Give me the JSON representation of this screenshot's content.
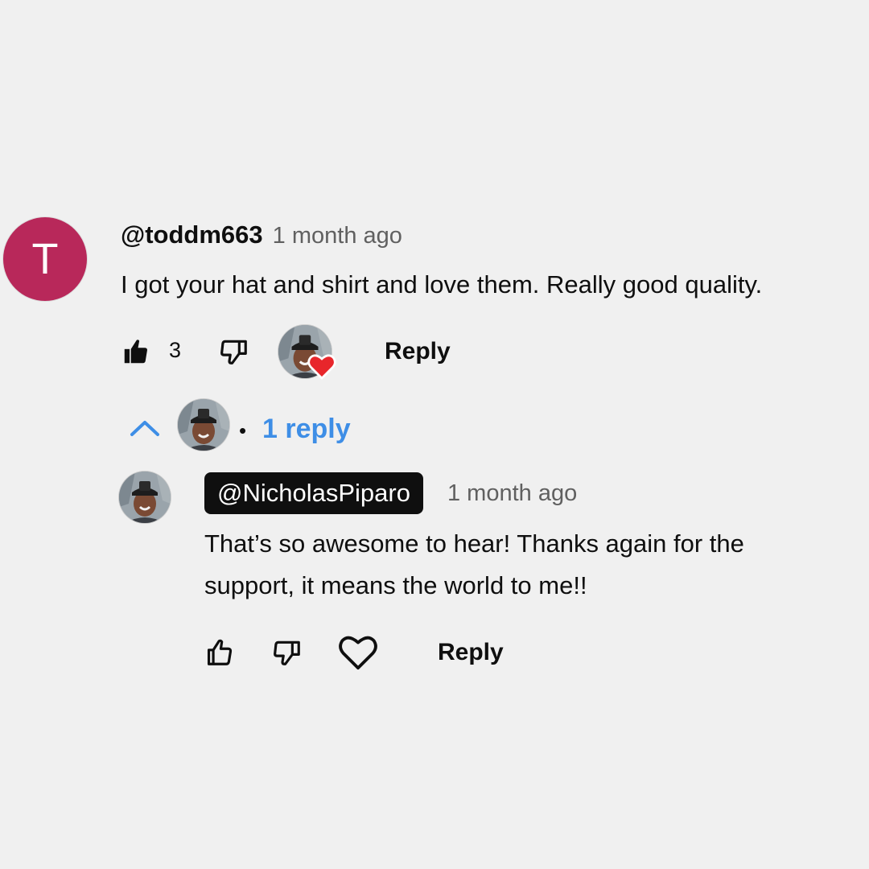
{
  "comment": {
    "avatar_letter": "T",
    "avatar_color": "#b8285a",
    "author": "@toddm663",
    "time": "1 month ago",
    "text": "I got your hat and shirt and love them. Really good quality.",
    "like_count": "3",
    "reply_label": "Reply",
    "creator_heart": true,
    "icons": [
      "like-filled-icon",
      "dislike-icon",
      "creator-heart-icon"
    ]
  },
  "replies_toggle": {
    "label": "1 reply",
    "separator": "•",
    "accent_color": "#3e8ee6",
    "icons": [
      "chevron-up-icon"
    ]
  },
  "reply": {
    "author": "@NicholasPiparo",
    "time": "1 month ago",
    "text_line1": "That’s so awesome to hear! Thanks again for the",
    "text_line2": "support, it means the world to me!!",
    "reply_label": "Reply",
    "icons": [
      "like-outline-icon",
      "dislike-icon",
      "heart-outline-icon"
    ]
  }
}
